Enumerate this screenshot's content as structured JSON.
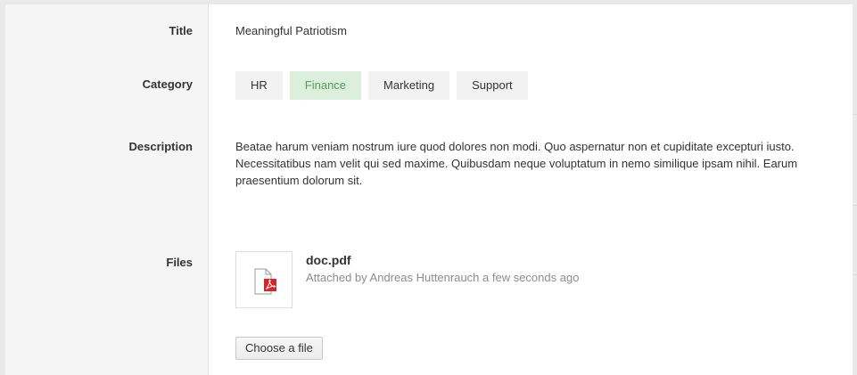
{
  "fields": {
    "title_label": "Title",
    "title_value": "Meaningful Patriotism",
    "category_label": "Category",
    "categories": [
      {
        "label": "HR",
        "active": false
      },
      {
        "label": "Finance",
        "active": true
      },
      {
        "label": "Marketing",
        "active": false
      },
      {
        "label": "Support",
        "active": false
      }
    ],
    "description_label": "Description",
    "description_value": "Beatae harum veniam nostrum iure quod dolores non modi. Quo aspernatur non et cupiditate excepturi iusto. Necessitatibus nam velit qui sed maxime. Quibusdam neque voluptatum in nemo similique ipsam nihil. Earum praesentium dolorum sit.",
    "files_label": "Files",
    "files": [
      {
        "name": "doc.pdf",
        "attached_text": "Attached by Andreas Huttenrauch a few seconds ago",
        "icon": "pdf-file-icon"
      }
    ],
    "choose_file_label": "Choose a file"
  },
  "colors": {
    "active_tab_bg": "#dcefdc",
    "active_tab_text": "#5a9a5a",
    "pdf_red": "#d9252a"
  }
}
